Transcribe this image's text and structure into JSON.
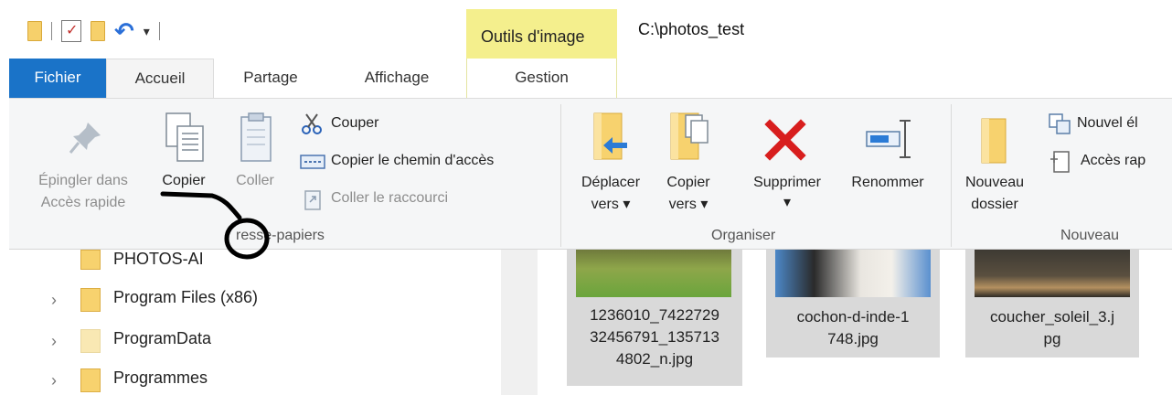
{
  "window": {
    "path": "C:\\photos_test",
    "contextual_tab": "Outils d'image"
  },
  "tabs": [
    "Fichier",
    "Accueil",
    "Partage",
    "Affichage",
    "Gestion"
  ],
  "clipboard": {
    "pin_line1": "Épingler dans",
    "pin_line2": "Accès rapide",
    "copy": "Copier",
    "paste": "Coller",
    "cut": "Couper",
    "copy_path": "Copier le chemin d'accès",
    "paste_shortcut": "Coller le raccourci",
    "group_label": "resse-papiers"
  },
  "organize": {
    "move_line1": "Déplacer",
    "move_line2": "vers",
    "copyto_line1": "Copier",
    "copyto_line2": "vers",
    "delete": "Supprimer",
    "rename": "Renommer",
    "group_label": "Organiser"
  },
  "new": {
    "newfolder_line1": "Nouveau",
    "newfolder_line2": "dossier",
    "new_item": "Nouvel él",
    "easy_access": "Accès rap",
    "group_label": "Nouveau"
  },
  "tree": [
    {
      "label": "PHOTOS-AI"
    },
    {
      "label": "Program Files (x86)"
    },
    {
      "label": "ProgramData"
    },
    {
      "label": "Programmes"
    }
  ],
  "files": [
    {
      "line1": "1236010_7422729",
      "line2": "32456791_135713",
      "line3": "4802_n.jpg"
    },
    {
      "line1": "cochon-d-inde-1",
      "line2": "748.jpg"
    },
    {
      "line1": "coucher_soleil_3.j",
      "line2": "pg"
    }
  ],
  "colors": {
    "file_tab": "#1a73c8",
    "contextual": "#f4ef8d",
    "delete": "#d81e1e",
    "folder": "#f7d26e"
  }
}
